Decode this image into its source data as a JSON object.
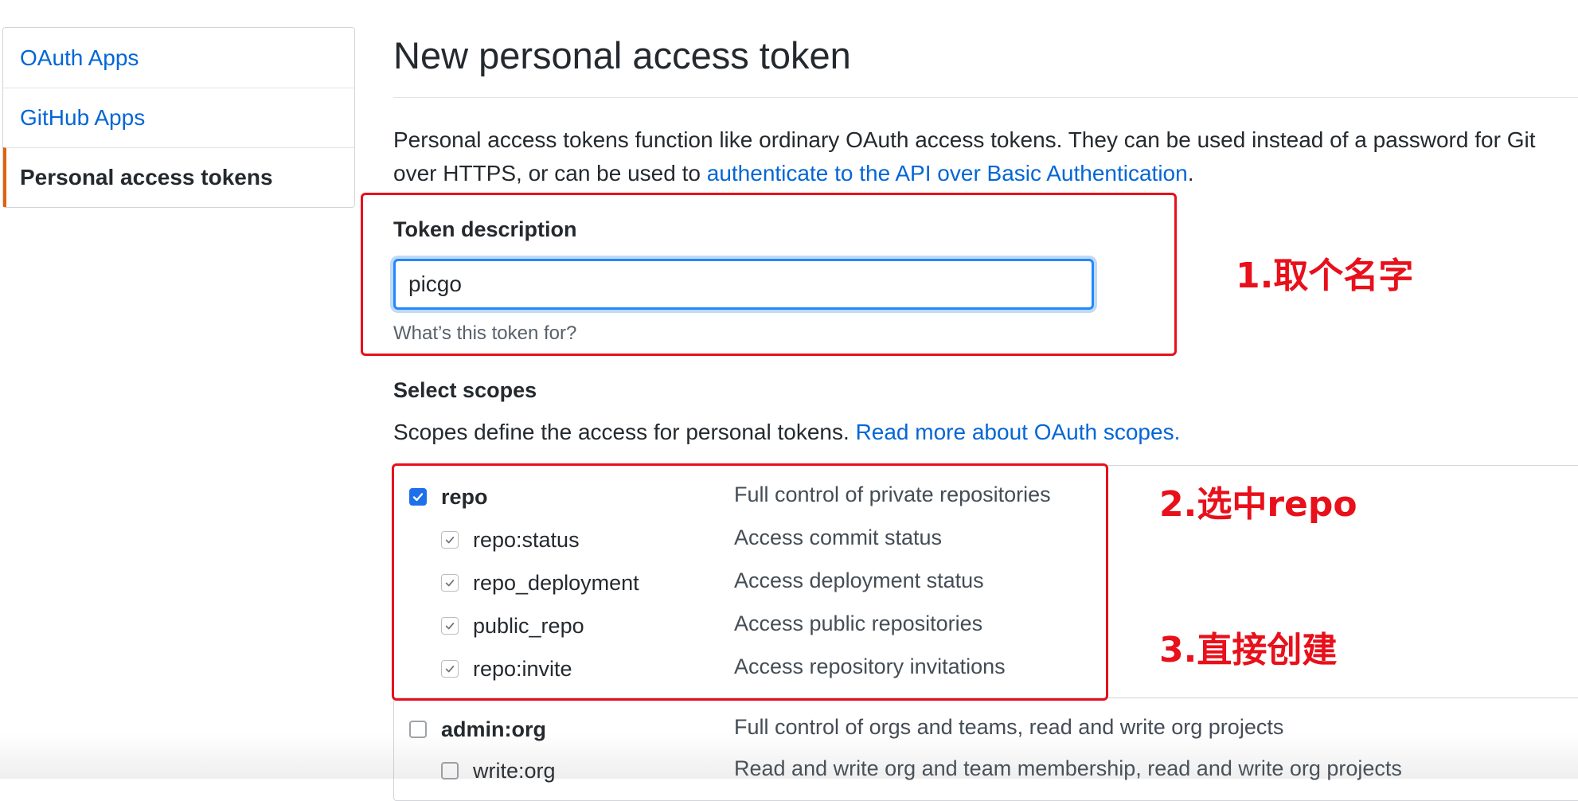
{
  "sidebar": {
    "items": [
      {
        "label": "OAuth Apps",
        "active": false
      },
      {
        "label": "GitHub Apps",
        "active": false
      },
      {
        "label": "Personal access tokens",
        "active": true
      }
    ]
  },
  "page": {
    "title": "New personal access token",
    "intro_text": "Personal access tokens function like ordinary OAuth access tokens. They can be used instead of a password for Git over HTTPS, or can be used to ",
    "intro_link": "authenticate to the API over Basic Authentication",
    "intro_end": "."
  },
  "token": {
    "label": "Token description",
    "value": "picgo",
    "hint": "What’s this token for?"
  },
  "scopes": {
    "heading": "Select scopes",
    "desc_text": "Scopes define the access for personal tokens. ",
    "desc_link": "Read more about OAuth scopes.",
    "rows": [
      {
        "name": "repo",
        "desc": "Full control of private repositories",
        "checked": true
      },
      {
        "name": "repo:status",
        "desc": "Access commit status",
        "checked": true
      },
      {
        "name": "repo_deployment",
        "desc": "Access deployment status",
        "checked": true
      },
      {
        "name": "public_repo",
        "desc": "Access public repositories",
        "checked": true
      },
      {
        "name": "repo:invite",
        "desc": "Access repository invitations",
        "checked": true
      },
      {
        "name": "admin:org",
        "desc": "Full control of orgs and teams, read and write org projects",
        "checked": false
      },
      {
        "name": "write:org",
        "desc": "Read and write org and team membership, read and write org projects",
        "checked": false
      }
    ]
  },
  "annotations": {
    "step1": "1.取个名字",
    "step2": "2.选中repo",
    "step3": "3.直接创建"
  },
  "colors": {
    "link": "#0366d6",
    "active_border": "#e36209",
    "annotation": "#e8101b",
    "focus": "#2188ff"
  }
}
